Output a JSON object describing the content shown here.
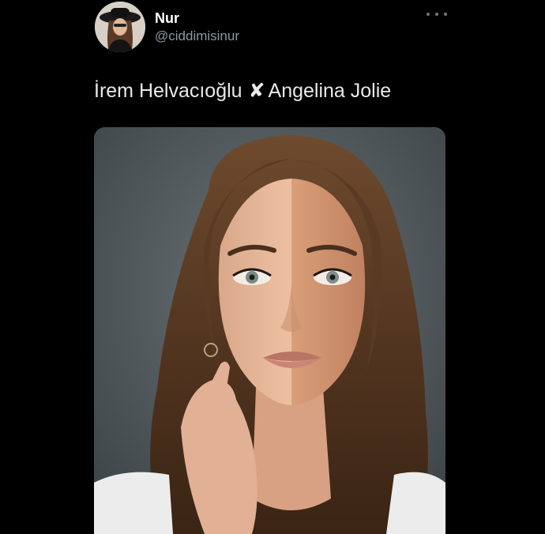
{
  "tweet": {
    "author": {
      "display_name": "Nur",
      "handle": "@ciddimisinur"
    },
    "text": {
      "name_left": "İrem Helvacıoğlu",
      "separator": "✘",
      "name_right": "Angelina Jolie"
    },
    "more_icon": "more-horizontal-icon"
  },
  "colors": {
    "background": "#000000",
    "text": "#e7e9ea",
    "secondary": "#8b98a5",
    "photo_backdrop": "#4c5356"
  }
}
